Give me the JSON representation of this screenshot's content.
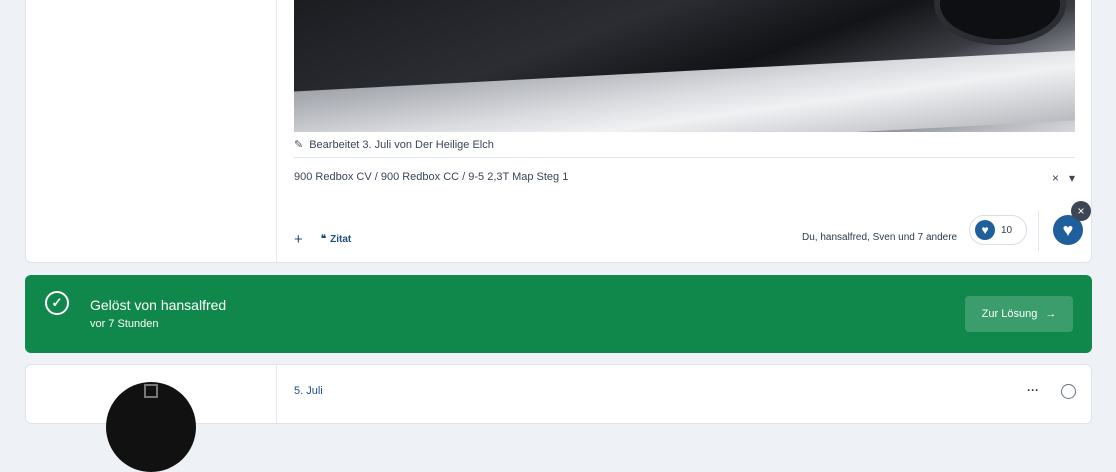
{
  "post1": {
    "edited_text": "Bearbeitet 3. Juli von Der Heilige Elch",
    "tag": "900 Redbox CV / 900 Redbox CC / 9-5 2,3T Map Steg 1",
    "tag_clear_icon": "×",
    "tag_dropdown_icon": "▾",
    "add_label": "+",
    "quote_label": "Zitat",
    "likes_text": "Du, hansalfred, Sven und 7 andere",
    "like_count": "10",
    "remove_like_icon": "×"
  },
  "solved": {
    "title": "Gelöst von hansalfred",
    "time": "vor 7 Stunden",
    "button_label": "Zur Lösung",
    "button_arrow": "→",
    "accent": "#10884b"
  },
  "post2": {
    "date": "5. Juli",
    "more_icon": "···"
  },
  "colors": {
    "link": "#1d4e89",
    "heart": "#1f5f9c"
  }
}
